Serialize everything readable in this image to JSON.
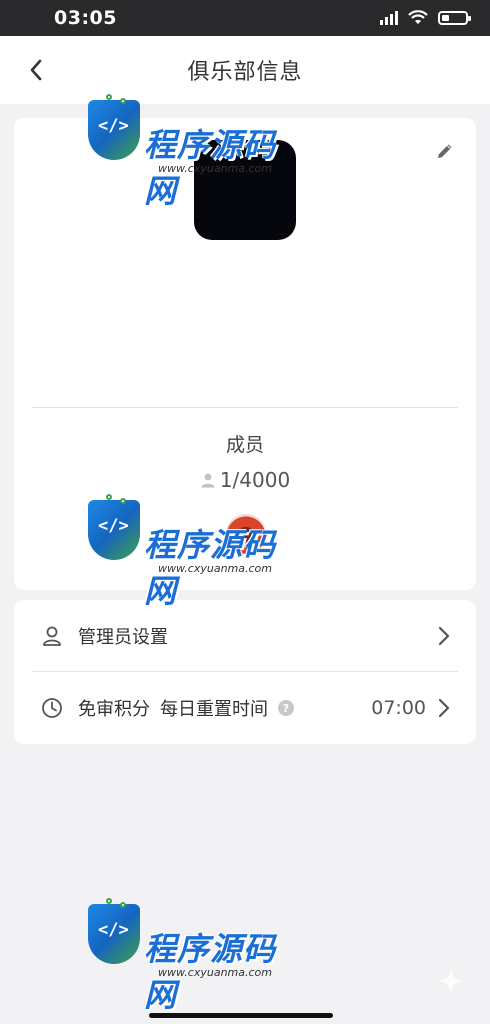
{
  "status_bar": {
    "time": "03:05",
    "battery_level": 0.3
  },
  "nav": {
    "title": "俱乐部信息",
    "back_icon": "chevron-left-icon"
  },
  "club": {
    "edit_icon": "pencil-icon",
    "members_label": "成员",
    "member_count": "1/4000",
    "member_count_icon": "person-icon"
  },
  "settings": {
    "admin": {
      "label": "管理员设置",
      "icon": "person-outline-icon"
    },
    "points_reset": {
      "label_main": "免审积分",
      "label_sub": "每日重置时间",
      "help_mark": "?",
      "value": "07:00",
      "icon": "clock-icon"
    }
  },
  "watermark": {
    "logo_code": "</>",
    "text": "程序源码网",
    "url": "www.cxyuanma.com"
  },
  "colors": {
    "page_bg": "#f2f2f4",
    "status_bar_bg": "#2a2a2c",
    "card_bg": "#ffffff",
    "avatar_bg": "#05070d",
    "watermark_blue": "#1a6fd6"
  }
}
